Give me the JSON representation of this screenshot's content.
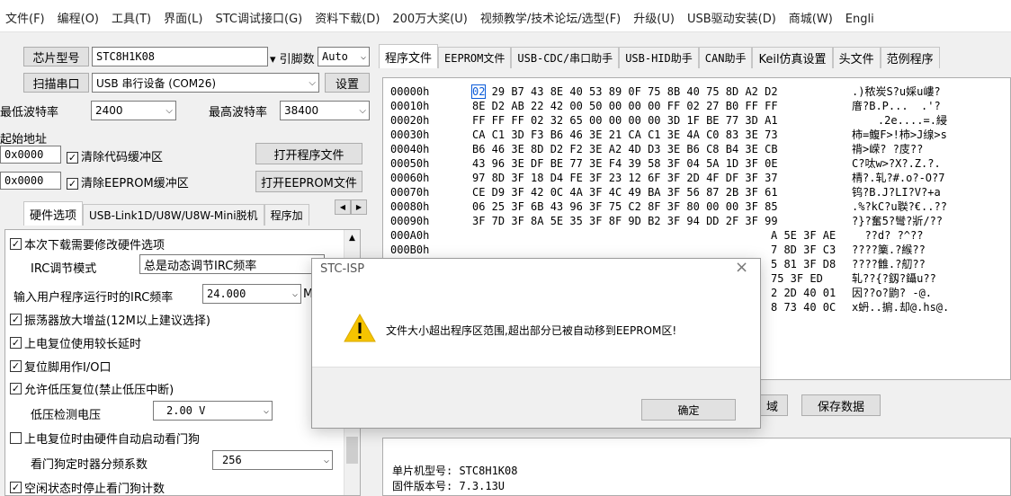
{
  "menu": [
    "文件(F)",
    "编程(O)",
    "工具(T)",
    "界面(L)",
    "STC调试接口(G)",
    "资料下载(D)",
    "200万大奖(U)",
    "视频教学/技术论坛/选型(F)",
    "升级(U)",
    "USB驱动安装(D)",
    "商城(W)",
    "Engli"
  ],
  "left": {
    "chip_btn": "芯片型号",
    "chip_value": "STC8H1K08",
    "pins_label": "引脚数",
    "pins_value": "Auto",
    "scan_btn": "扫描串口",
    "port_value": "USB 串行设备 (COM26)",
    "settings_btn": "设置",
    "min_baud_label": "最低波特率",
    "min_baud_value": "2400",
    "max_baud_label": "最高波特率",
    "max_baud_value": "38400",
    "start_addr_label": "起始地址",
    "addr1": "0x0000",
    "clear_code_label": "清除代码缓冲区",
    "open_prog_btn": "打开程序文件",
    "addr2": "0x0000",
    "clear_eeprom_label": "清除EEPROM缓冲区",
    "open_eeprom_btn": "打开EEPROM文件",
    "tabs": [
      "硬件选项",
      "USB-Link1D/U8W/U8W-Mini脱机",
      "程序加"
    ],
    "options": {
      "opt_modify_hw": "本次下载需要修改硬件选项",
      "irc_mode_label": "IRC调节模式",
      "irc_mode_value": "总是动态调节IRC频率",
      "irc_freq_label": "输入用户程序运行时的IRC频率",
      "irc_freq_value": "24.000",
      "irc_freq_unit": "M",
      "opt_osc_gain": "振荡器放大增益(12M以上建议选择)",
      "opt_poweron_delay": "上电复位使用较长延时",
      "opt_reset_io": "复位脚用作I/O口",
      "opt_lvd_reset": "允许低压复位(禁止低压中断)",
      "lvd_label": "低压检测电压",
      "lvd_value": "2.00 V",
      "opt_wdt_hw": "上电复位时由硬件自动启动看门狗",
      "wdt_div_label": "看门狗定时器分频系数",
      "wdt_div_value": "256",
      "opt_idle_wdt": "空闲状态时停止看门狗计数"
    }
  },
  "right": {
    "tabs": [
      "程序文件",
      "EEPROM文件",
      "USB-CDC/串口助手",
      "USB-HID助手",
      "CAN助手",
      "Keil仿真设置",
      "头文件",
      "范例程序"
    ],
    "hex_rows": [
      {
        "addr": "00000h",
        "bytes": "02 29 B7 43 8E 40 53 89 0F 75 8B 40 75 8D A2 D2",
        "ascii": ".)秾炭S?u婇u嶁?"
      },
      {
        "addr": "00010h",
        "bytes": "8E D2 AB 22 42 00 50 00 00 00 FF 02 27 B0 FF FF",
        "ascii": "庴?B.P...  .'?"
      },
      {
        "addr": "00020h",
        "bytes": "FF FF FF 02 32 65 00 00 00 00 3D 1F BE 77 3D A1",
        "ascii": "    .2e....=.綅"
      },
      {
        "addr": "00030h",
        "bytes": "CA C1 3D F3 B6 46 3E 21 CA C1 3E 4A C0 83 3E 73",
        "ascii": "柿=鳆F>!柿>J缐>s"
      },
      {
        "addr": "00040h",
        "bytes": "B6 46 3E 8D D2 F2 3E A2 4D D3 3E B6 C8 B4 3E CB",
        "ascii": "禙>嵘? ?庋??"
      },
      {
        "addr": "00050h",
        "bytes": "43 96 3E DF BE 77 3E F4 39 58 3F 04 5A 1D 3F 0E",
        "ascii": "C?呔w>?X?.Z.?."
      },
      {
        "addr": "00060h",
        "bytes": "97 8D 3F 18 D4 FE 3F 23 12 6F 3F 2D 4F DF 3F 37",
        "ascii": "棈?.轧?#.o?-O?7"
      },
      {
        "addr": "00070h",
        "bytes": "CE D9 3F 42 0C 4A 3F 4C 49 BA 3F 56 87 2B 3F 61",
        "ascii": "钨?B.J?LI?V?+a"
      },
      {
        "addr": "00080h",
        "bytes": "06 25 3F 6B 43 96 3F 75 C2 8F 3F 80 00 00 3F 85",
        "ascii": ".%?kC?u聫?€..??"
      },
      {
        "addr": "00090h",
        "bytes": "3F 7D 3F 8A 5E 35 3F 8F 9D B2 3F 94 DD 2F 3F 99",
        "ascii": "?}?奮5?彎?斨/??"
      },
      {
        "addr": "000A0h",
        "bytes": "A 5E 3F AE",
        "ascii": "  ??d? ?^??"
      },
      {
        "addr": "000B0h",
        "bytes": "7 8D 3F C3",
        "ascii": "????篥.?緱??"
      },
      {
        "addr": "000C0h",
        "bytes": "5 81 3F D8",
        "ascii": "????雔.?舠??"
      },
      {
        "addr": "000D0h",
        "bytes": "75 3F ED",
        "ascii": "轧??{?釼?鑷u??"
      },
      {
        "addr": "000E0h",
        "bytes": "2 2D 40 01",
        "ascii": "因??o?鼩? -@."
      },
      {
        "addr": "000F0h",
        "bytes": "8 73 40 0C",
        "ascii": "x蚒..掮.却@.hs@."
      }
    ],
    "btn_area": "域",
    "btn_save": "保存数据",
    "info_mcu": "单片机型号: STC8H1K08",
    "info_fw": "固件版本号: 7.3.13U"
  },
  "dialog": {
    "title": "STC-ISP",
    "message": "文件大小超出程序区范围,超出部分已被自动移到EEPROM区!",
    "ok": "确定"
  },
  "colors": {
    "warning": "#f5c400",
    "highlight": "#0a5bd9"
  }
}
